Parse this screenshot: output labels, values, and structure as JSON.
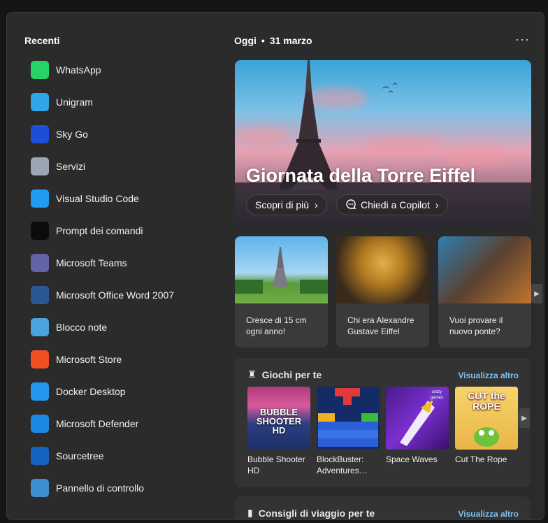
{
  "recent": {
    "title": "Recenti",
    "apps": [
      {
        "label": "WhatsApp",
        "icon": "whatsapp-icon",
        "color": "#25d366"
      },
      {
        "label": "Unigram",
        "icon": "unigram-icon",
        "color": "#2ea6e8"
      },
      {
        "label": "Sky Go",
        "icon": "sky-go-icon",
        "color": "#1a4fd6"
      },
      {
        "label": "Servizi",
        "icon": "services-gear-icon",
        "color": "#9aa6b2"
      },
      {
        "label": "Visual Studio Code",
        "icon": "vscode-icon",
        "color": "#1f9cf0"
      },
      {
        "label": "Prompt dei comandi",
        "icon": "command-prompt-icon",
        "color": "#0c0c0c"
      },
      {
        "label": "Microsoft Teams",
        "icon": "teams-icon",
        "color": "#6264a7"
      },
      {
        "label": "Microsoft Office Word 2007",
        "icon": "word-icon",
        "color": "#2b5797"
      },
      {
        "label": "Blocco note",
        "icon": "notepad-icon",
        "color": "#4aa3df"
      },
      {
        "label": "Microsoft Store",
        "icon": "store-icon",
        "color": "#f25022"
      },
      {
        "label": "Docker Desktop",
        "icon": "docker-icon",
        "color": "#2496ed"
      },
      {
        "label": "Microsoft Defender",
        "icon": "defender-icon",
        "color": "#1e88e5"
      },
      {
        "label": "Sourcetree",
        "icon": "sourcetree-icon",
        "color": "#1565c0"
      },
      {
        "label": "Pannello di controllo",
        "icon": "control-panel-icon",
        "color": "#3d8fd1"
      }
    ]
  },
  "header": {
    "today": "Oggi",
    "date": "31 marzo",
    "more": "···"
  },
  "hero": {
    "title": "Giornata della Torre Eiffel",
    "btn_learn": "Scopri di più",
    "btn_copilot": "Chiedi a Copilot"
  },
  "cards": [
    {
      "text": "Cresce di 15 cm ogni anno!"
    },
    {
      "text": "Chi era Alexandre Gustave Eiffel"
    },
    {
      "text": "Vuoi provare il nuovo ponte?"
    }
  ],
  "games": {
    "title": "Giochi per te",
    "link": "Visualizza altro",
    "items": [
      {
        "name": "Bubble Shooter HD",
        "art": "BUBBLE SHOOTER HD"
      },
      {
        "name": "BlockBuster: Adventures…"
      },
      {
        "name": "Space Waves",
        "badge": "crazy games"
      },
      {
        "name": "Cut The Rope",
        "art": "CUT the ROPE"
      }
    ]
  },
  "travel": {
    "title": "Consigli di viaggio per te",
    "link": "Visualizza altro"
  }
}
